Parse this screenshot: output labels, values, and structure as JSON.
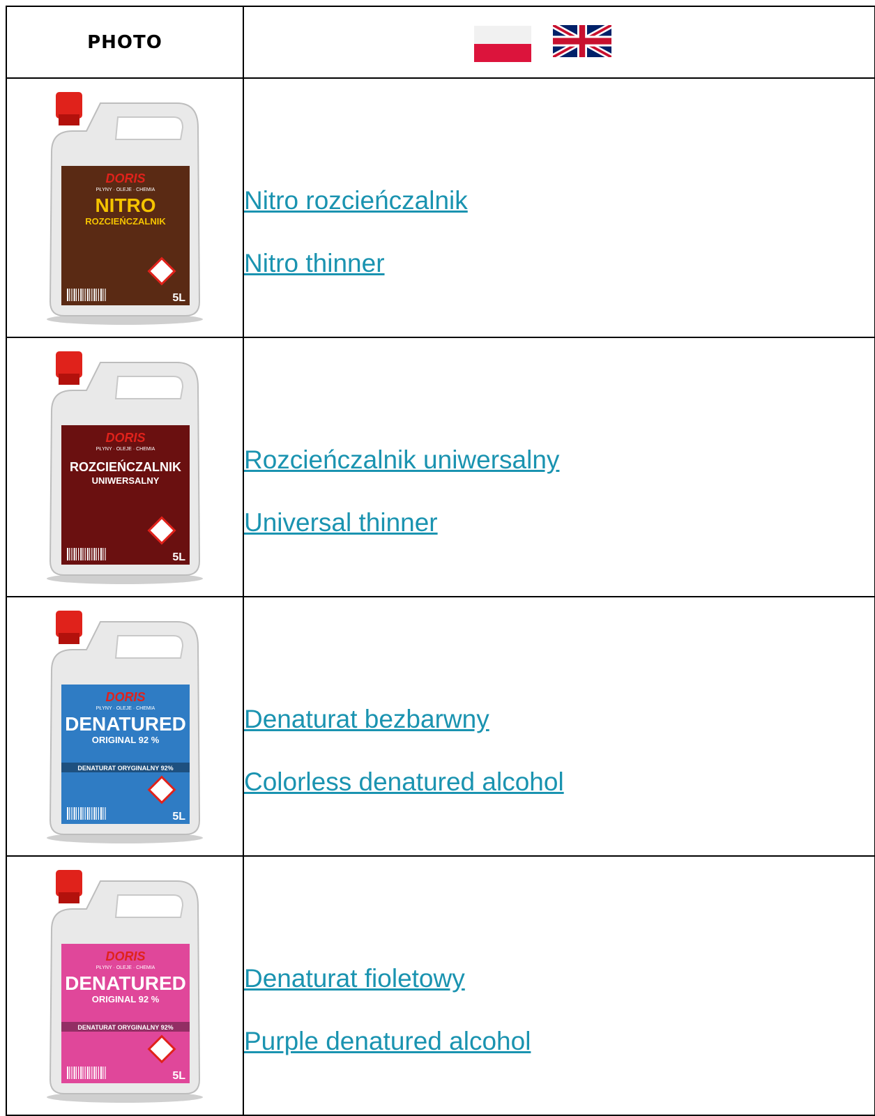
{
  "header": {
    "photo_label": "PHOTO",
    "flags": [
      {
        "icon": "poland-flag-icon",
        "colors": [
          "#f1f1f1",
          "#dc143c"
        ]
      },
      {
        "icon": "uk-flag-icon",
        "colors": [
          "#012169",
          "#ffffff",
          "#c8102e"
        ]
      }
    ]
  },
  "products": [
    {
      "name_pl": "Nitro rozcieńczalnik",
      "name_en": "Nitro thinner",
      "label": {
        "brand": "DORIS",
        "tagline": "PŁYNY · OLEJE · CHEMIA",
        "title_line1": "NITRO",
        "title_line2": "ROZCIEŃCZALNIK",
        "volume": "5L",
        "label_color": "#5a2a14",
        "title_color": "#f5c400"
      }
    },
    {
      "name_pl": "Rozcieńczalnik uniwersalny",
      "name_en": "Universal thinner",
      "label": {
        "brand": "DORIS",
        "tagline": "PŁYNY · OLEJE · CHEMIA",
        "title_line1": "ROZCIEŃCZALNIK",
        "title_line2": "UNIWERSALNY",
        "volume": "5L",
        "label_color": "#6a1010",
        "title_color": "#ffffff"
      }
    },
    {
      "name_pl": "Denaturat bezbarwny",
      "name_en": "Colorless denatured alcohol",
      "label": {
        "brand": "DORIS",
        "tagline": "PŁYNY · OLEJE · CHEMIA",
        "title_line1": "DENATURED",
        "title_line2": "ORIGINAL 92 %",
        "band": "DENATURAT ORYGINALNY 92%",
        "volume": "5L",
        "label_color": "#2f7cc4",
        "title_color": "#ffffff"
      }
    },
    {
      "name_pl": "Denaturat fioletowy",
      "name_en": "Purple denatured alcohol",
      "label": {
        "brand": "DORIS",
        "tagline": "PŁYNY · OLEJE · CHEMIA",
        "title_line1": "DENATURED",
        "title_line2": "ORIGINAL 92 %",
        "band": "DENATURAT ORYGINALNY 92%",
        "volume": "5L",
        "label_color": "#e0479a",
        "title_color": "#ffffff"
      }
    }
  ]
}
